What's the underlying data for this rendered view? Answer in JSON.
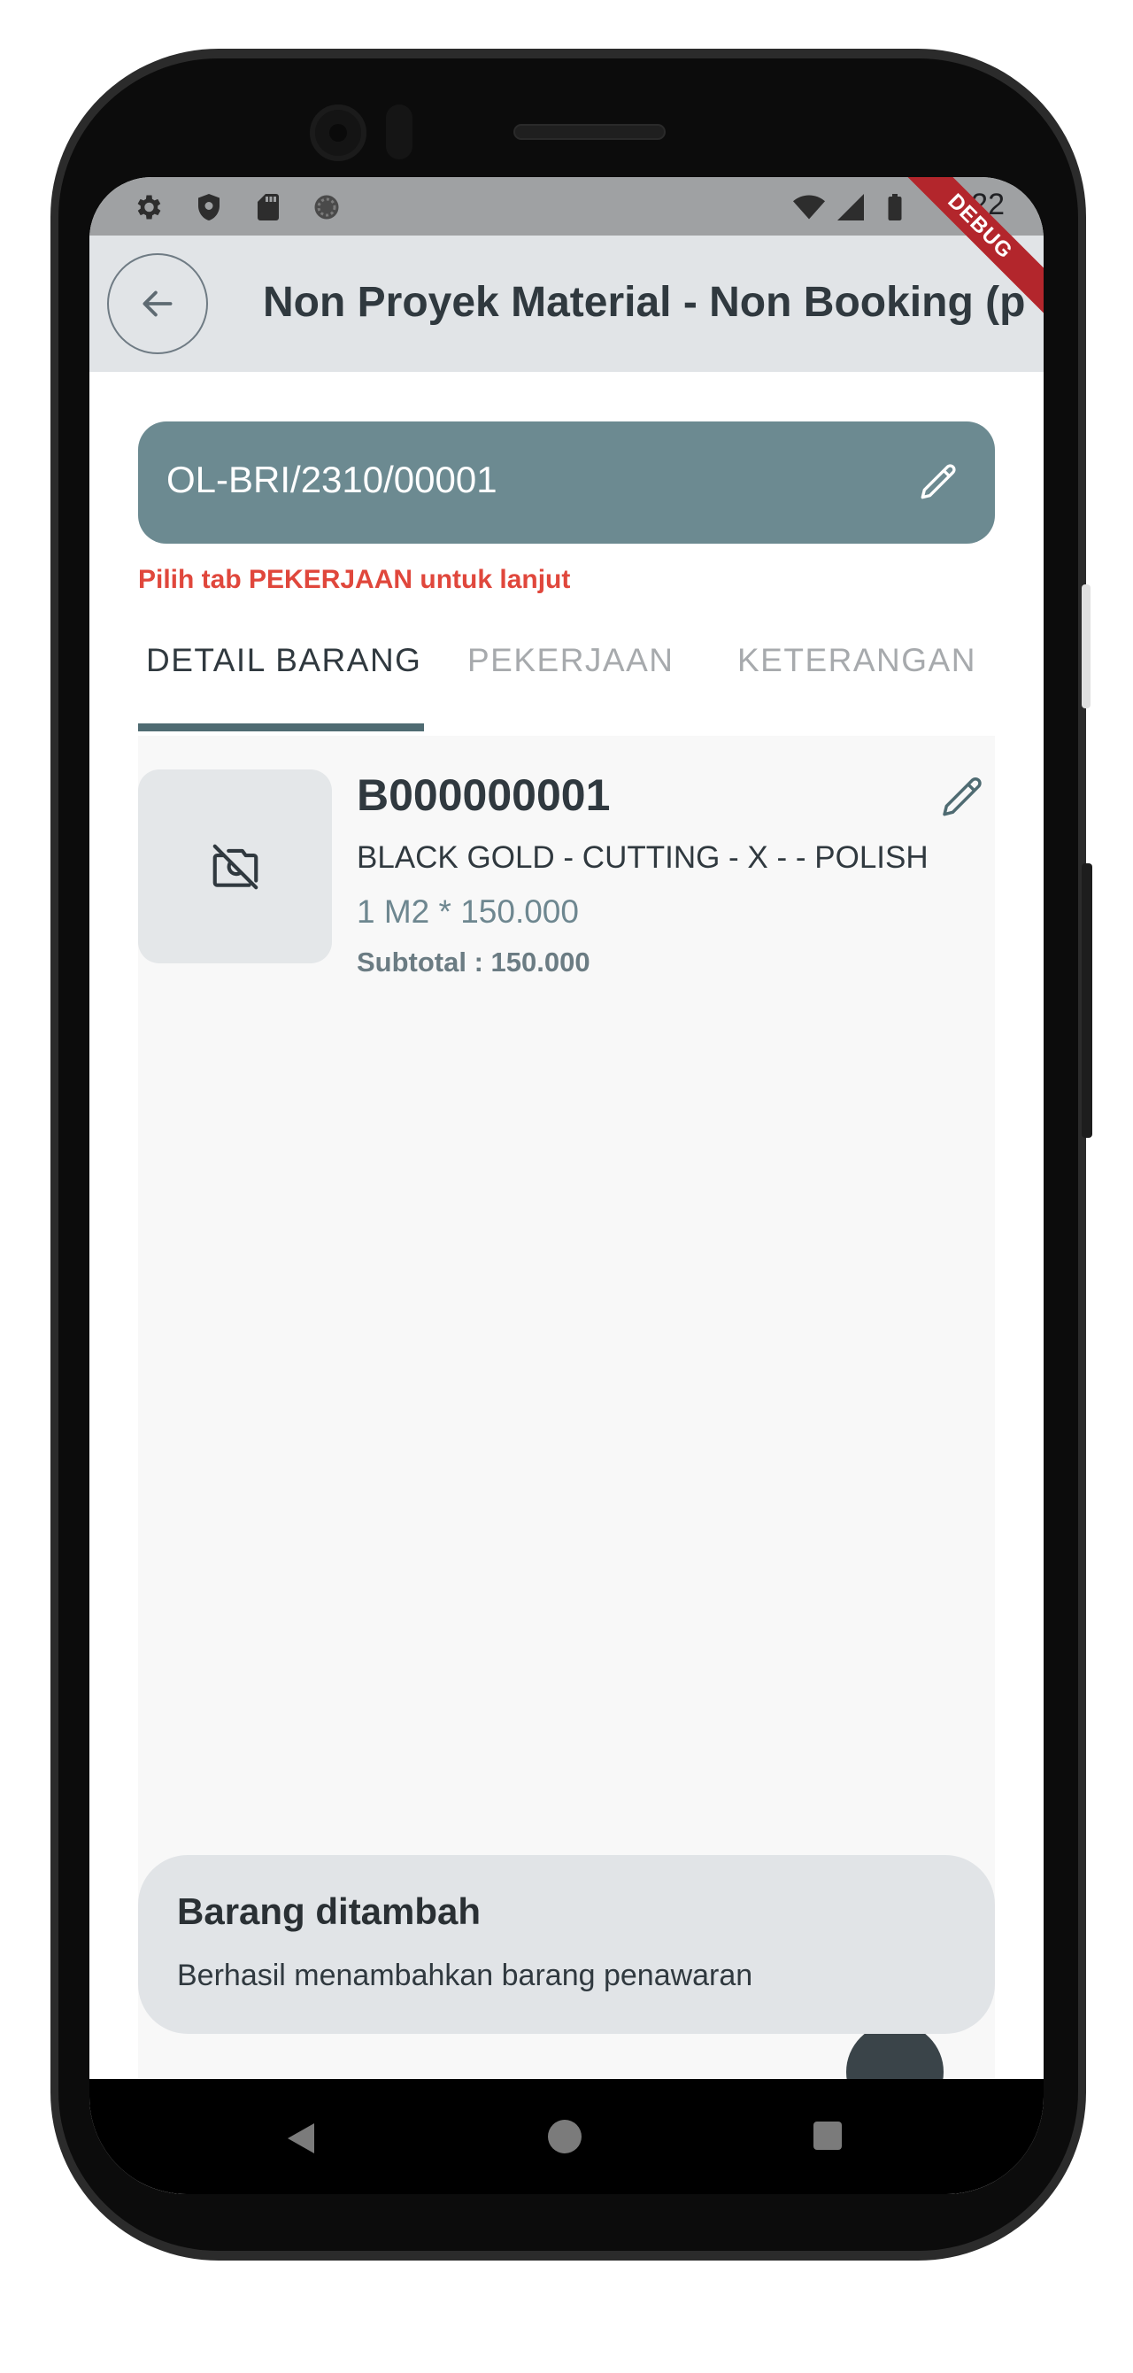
{
  "status_bar": {
    "time": "7:22",
    "left_icons": [
      "gear-icon",
      "shield-icon",
      "sd-card-icon",
      "dots-icon"
    ],
    "right_icons": [
      "wifi-icon",
      "signal-icon",
      "battery-icon"
    ],
    "debug_label": "DEBUG"
  },
  "app_bar": {
    "title": "Non Proyek Material - Non Booking (p"
  },
  "project": {
    "code": "OL-BRI/2310/00001"
  },
  "warning_text": "Pilih tab PEKERJAAN untuk lanjut",
  "tabs": [
    {
      "label": "DETAIL BARANG",
      "active": true
    },
    {
      "label": "PEKERJAAN",
      "active": false
    },
    {
      "label": "KETERANGAN",
      "active": false
    }
  ],
  "items": [
    {
      "code": "B000000001",
      "name": "BLACK GOLD - CUTTING - X - - POLISH",
      "quantity_line": "1 M2 * 150.000",
      "subtotal": "Subtotal : 150.000"
    }
  ],
  "snackbar": {
    "title": "Barang ditambah",
    "message": "Berhasil menambahkan barang penawaran"
  },
  "colors": {
    "accent": "#6c8a91",
    "warning": "#e0473c",
    "app_bar": "#e1e4e7",
    "text_dark": "#30393f"
  }
}
